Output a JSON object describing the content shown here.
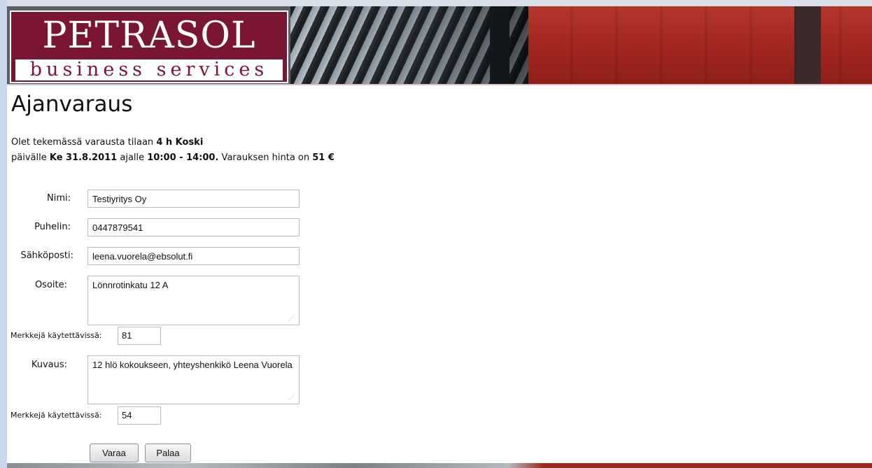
{
  "branding": {
    "logo_main": "PETRASOL",
    "logo_sub": "business services"
  },
  "page": {
    "title": "Ajanvaraus",
    "intro_line1_prefix": "Olet tekemässä varausta tilaan ",
    "intro_room": "4 h Koski",
    "intro_line2_prefix": "päivälle ",
    "intro_date": "Ke 31.8.2011",
    "intro_time_prefix": " ajalle ",
    "intro_time": "10:00 - 14:00.",
    "intro_price_prefix": " Varauksen hinta on ",
    "intro_price": "51 €"
  },
  "form": {
    "name_label": "Nimi:",
    "name_value": "Testiyritys Oy",
    "phone_label": "Puhelin:",
    "phone_value": "0447879541",
    "email_label": "Sähköposti:",
    "email_value": "leena.vuorela@ebsolut.fi",
    "address_label": "Osoite:",
    "address_value": "Lönnrotinkatu 12 A",
    "address_counter_label": "Merkkejä käytettävissä:",
    "address_counter_value": "81",
    "description_label": "Kuvaus:",
    "description_value": "12 hlö kokoukseen, yhteyshenkikö Leena Vuorela",
    "description_counter_label": "Merkkejä käytettävissä:",
    "description_counter_value": "54"
  },
  "buttons": {
    "reserve": "Varaa",
    "back": "Palaa"
  },
  "colors": {
    "brand": "#7a1533",
    "banner_red": "#a4281f"
  }
}
